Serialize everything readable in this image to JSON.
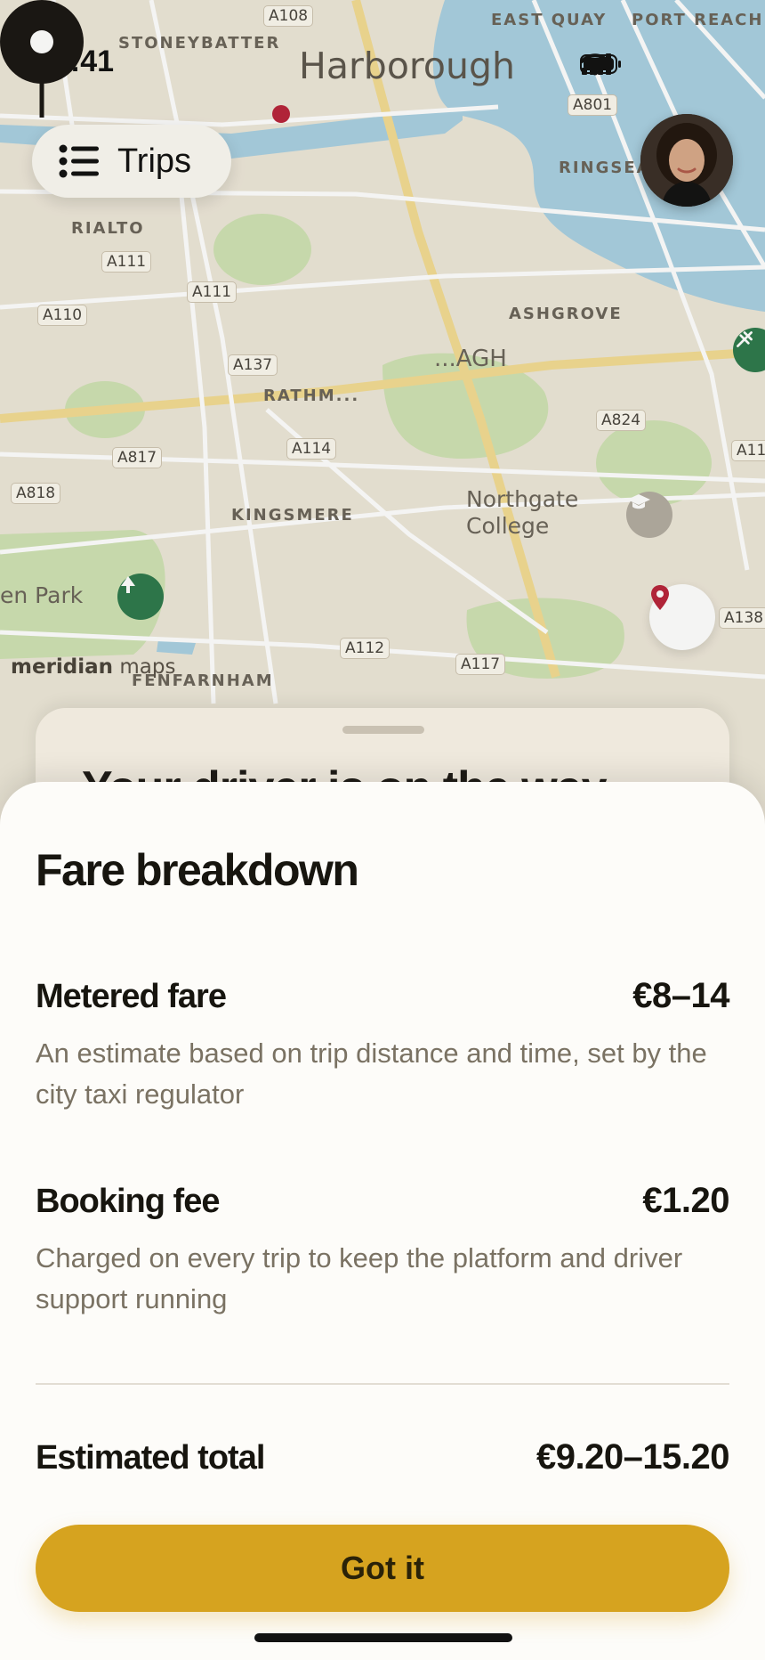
{
  "status_bar": {
    "time": "9:41"
  },
  "map": {
    "city_name": "Harborough",
    "areas": [
      "STONEYBATTER",
      "EAST QUAY",
      "PORT REACH",
      "RINGSEA",
      "RIALTO",
      "ASHGROVE",
      "RATHM...",
      "KINGSMERE",
      "FENFARNHAM"
    ],
    "places": [
      "...AGH",
      "Northgate College",
      "en Park"
    ],
    "roads": [
      "A108",
      "A801",
      "A111",
      "A111",
      "A110",
      "A137",
      "A824",
      "A114",
      "A817",
      "A818",
      "A11",
      "A138",
      "A112",
      "A117"
    ],
    "attribution_brand": "meridian",
    "attribution_suffix": " maps",
    "water_color": "#a9d0e2",
    "park_color": "#cfe2b4",
    "major_road_color": "#f3dc93"
  },
  "header": {
    "trips_label": "Trips",
    "trips_icon": "list-icon",
    "avatar_icon": "profile-avatar"
  },
  "obscured_sheet_title": "Your driver is on the way",
  "fare_sheet": {
    "title": "Fare breakdown",
    "items": [
      {
        "label": "Metered fare",
        "amount": "€8–14",
        "description": "An estimate based on trip distance and time, set by the city taxi regulator"
      },
      {
        "label": "Booking fee",
        "amount": "€1.20",
        "description": "Charged on every trip to keep the platform and driver support running"
      }
    ],
    "total_label": "Estimated total",
    "total_amount": "€9.20–15.20",
    "confirm_label": "Got it",
    "accent_color": "#d6a31f"
  }
}
